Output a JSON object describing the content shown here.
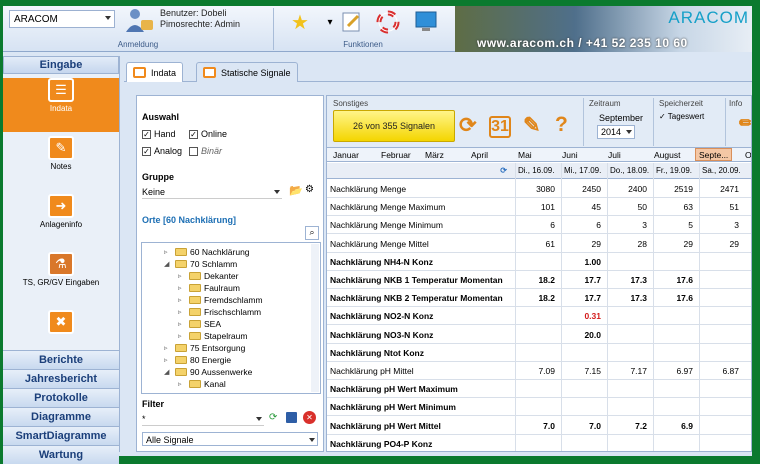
{
  "ribbon": {
    "app_select": "ARACOM",
    "user_label": "Benutzer: Dobeli",
    "rights_label": "Pimosrechte: Admin",
    "group_anmeldung": "Anmeldung",
    "group_funktionen": "Funktionen",
    "brand_logo": "ARACOM",
    "brand_url": "www.aracom.ch / +41 52 235 10 60"
  },
  "nav": {
    "top": "Eingabe",
    "items": [
      {
        "label": "Indata",
        "icon": "list-icon",
        "active": true
      },
      {
        "label": "Notes",
        "icon": "notes-icon",
        "active": false
      },
      {
        "label": "Anlageninfo",
        "icon": "info-icon",
        "active": false
      },
      {
        "label": "TS, GR/GV Eingaben",
        "icon": "lab-flask-icon",
        "active": false
      },
      {
        "label": "",
        "icon": "tools-icon",
        "active": false
      }
    ],
    "buttons": [
      "Berichte",
      "Jahresbericht",
      "Protokolle",
      "Diagramme",
      "SmartDiagramme",
      "Wartung"
    ]
  },
  "tabs": [
    "Indata",
    "Statische Signale"
  ],
  "panel": {
    "auswahl_title": "Auswahl",
    "checkboxes": [
      {
        "label": "Hand",
        "checked": true
      },
      {
        "label": "Online",
        "checked": true
      },
      {
        "label": "Analog",
        "checked": true
      },
      {
        "label": "Binär",
        "checked": false
      }
    ],
    "gruppe_title": "Gruppe",
    "gruppe_value": "Keine",
    "orte_title": "Orte",
    "orte_badge": "[60 Nachklärung]",
    "tree": [
      {
        "label": "60 Nachklärung",
        "level": 1,
        "arrow": "▹"
      },
      {
        "label": "70 Schlamm",
        "level": 1,
        "arrow": "◢"
      },
      {
        "label": "Dekanter",
        "level": 2,
        "arrow": "▹"
      },
      {
        "label": "Faulraum",
        "level": 2,
        "arrow": "▹"
      },
      {
        "label": "Fremdschlamm",
        "level": 2,
        "arrow": "▹"
      },
      {
        "label": "Frischschlamm",
        "level": 2,
        "arrow": "▹"
      },
      {
        "label": "SEA",
        "level": 2,
        "arrow": "▹"
      },
      {
        "label": "Stapelraum",
        "level": 2,
        "arrow": "▹"
      },
      {
        "label": "75 Entsorgung",
        "level": 1,
        "arrow": "▹"
      },
      {
        "label": "80 Energie",
        "level": 1,
        "arrow": "▹"
      },
      {
        "label": "90 Aussenwerke",
        "level": 1,
        "arrow": "◢"
      },
      {
        "label": "Kanal",
        "level": 2,
        "arrow": "▹"
      }
    ],
    "filter_title": "Filter",
    "filter_value": "*",
    "signals_value": "Alle Signale"
  },
  "toolbar": {
    "sonstiges_label": "Sonstiges",
    "signals_button": "26 von 355 Signalen",
    "zeitraum_label": "Zeitraum",
    "zeitraum_month": "September",
    "zeitraum_year": "2014",
    "speicherzeit_label": "Speicherzeit",
    "speicherzeit_value": "✓ Tageswert",
    "info_label": "Info"
  },
  "months": [
    "Januar",
    "Februar",
    "März",
    "April",
    "Mai",
    "Juni",
    "Juli",
    "August",
    "Septe...",
    "O"
  ],
  "columns": [
    "Di., 16.09.",
    "Mi., 17.09.",
    "Do., 18.09.",
    "Fr., 19.09.",
    "Sa., 20.09."
  ],
  "rows": [
    {
      "name": "Nachklärung Menge",
      "bold": false,
      "values": [
        "3080",
        "2450",
        "2400",
        "2519",
        "2471"
      ]
    },
    {
      "name": "Nachklärung Menge Maximum",
      "bold": false,
      "values": [
        "101",
        "45",
        "50",
        "63",
        "51"
      ]
    },
    {
      "name": "Nachklärung Menge Minimum",
      "bold": false,
      "values": [
        "6",
        "6",
        "3",
        "5",
        "3"
      ]
    },
    {
      "name": "Nachklärung Menge Mittel",
      "bold": false,
      "values": [
        "61",
        "29",
        "28",
        "29",
        "29"
      ]
    },
    {
      "name": "Nachklärung NH4-N Konz",
      "bold": true,
      "values": [
        "",
        "1.00",
        "",
        "",
        ""
      ]
    },
    {
      "name": "Nachklärung NKB 1 Temperatur Momentan",
      "bold": true,
      "values": [
        "18.2",
        "17.7",
        "17.3",
        "17.6",
        ""
      ]
    },
    {
      "name": "Nachklärung NKB 2 Temperatur Momentan",
      "bold": true,
      "values": [
        "18.2",
        "17.7",
        "17.3",
        "17.6",
        ""
      ]
    },
    {
      "name": "Nachklärung NO2-N Konz",
      "bold": true,
      "values": [
        "",
        "0.31",
        "",
        "",
        ""
      ],
      "red": [
        1
      ]
    },
    {
      "name": "Nachklärung NO3-N Konz",
      "bold": true,
      "values": [
        "",
        "20.0",
        "",
        "",
        ""
      ]
    },
    {
      "name": "Nachklärung Ntot Konz",
      "bold": true,
      "values": [
        "",
        "",
        "",
        "",
        ""
      ]
    },
    {
      "name": "Nachklärung pH Mittel",
      "bold": false,
      "values": [
        "7.09",
        "7.15",
        "7.17",
        "6.97",
        "6.87"
      ]
    },
    {
      "name": "Nachklärung pH Wert Maximum",
      "bold": true,
      "values": [
        "",
        "",
        "",
        "",
        ""
      ]
    },
    {
      "name": "Nachklärung pH Wert Minimum",
      "bold": true,
      "values": [
        "",
        "",
        "",
        "",
        ""
      ]
    },
    {
      "name": "Nachklärung pH Wert Mittel",
      "bold": true,
      "values": [
        "7.0",
        "7.0",
        "7.2",
        "6.9",
        ""
      ]
    },
    {
      "name": "Nachklärung PO4-P Konz",
      "bold": true,
      "values": [
        "",
        "",
        "",
        "",
        ""
      ]
    }
  ]
}
